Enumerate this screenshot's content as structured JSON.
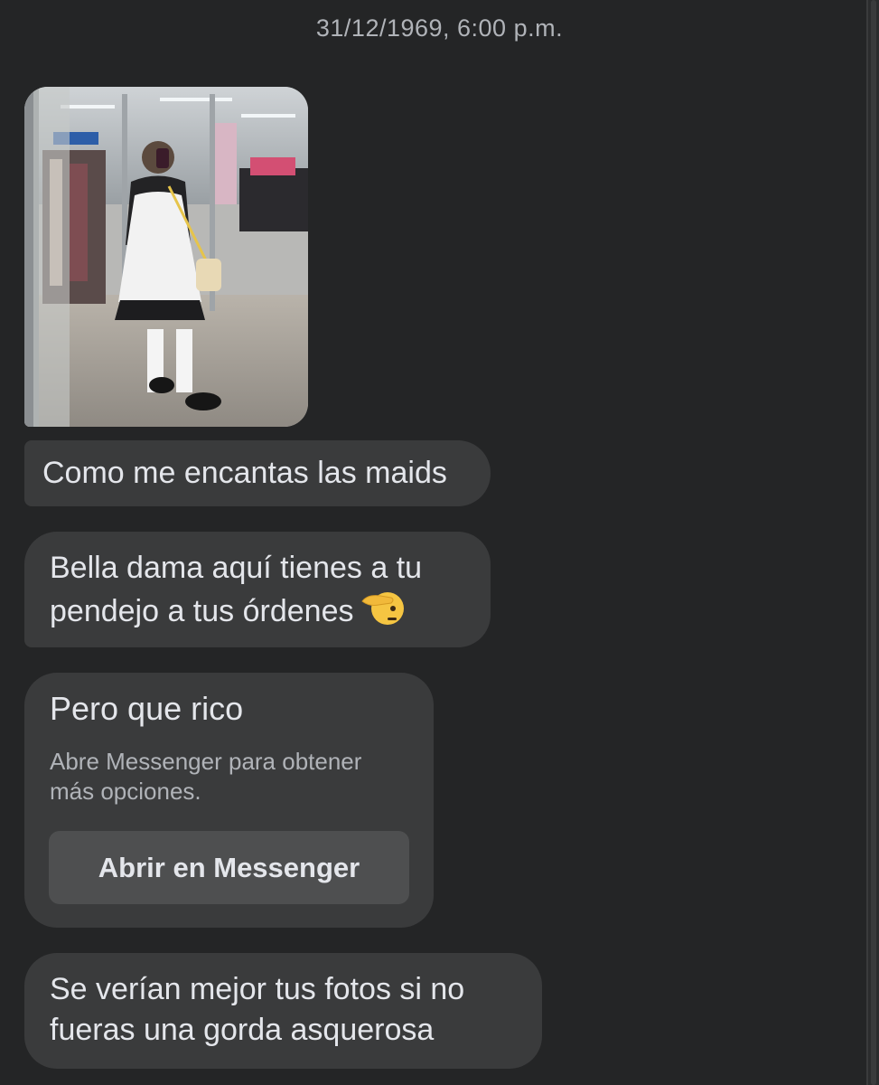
{
  "header": {
    "timestamp": "31/12/1969, 6:00 p.m."
  },
  "messages": [
    {
      "type": "image",
      "description": "photo-attachment"
    },
    {
      "type": "text",
      "text": "Como me encantas las maids"
    },
    {
      "type": "text",
      "lines": [
        "Bella dama aquí tienes a tu",
        "pendejo a tus órdenes"
      ],
      "emoji": "saluting-face-emoji"
    },
    {
      "type": "unsupported",
      "text": "Pero que rico",
      "note_lines": [
        "Abre Messenger para obtener",
        "más opciones."
      ],
      "button_label": "Abrir en Messenger"
    },
    {
      "type": "text",
      "lines": [
        "Se verían mejor tus fotos si no",
        "fueras una gorda asquerosa"
      ]
    }
  ],
  "colors": {
    "background": "#242526",
    "bubble": "#3a3b3c",
    "button": "#4e4f50",
    "text": "#e4e6eb",
    "muted": "#b0b3b8"
  }
}
